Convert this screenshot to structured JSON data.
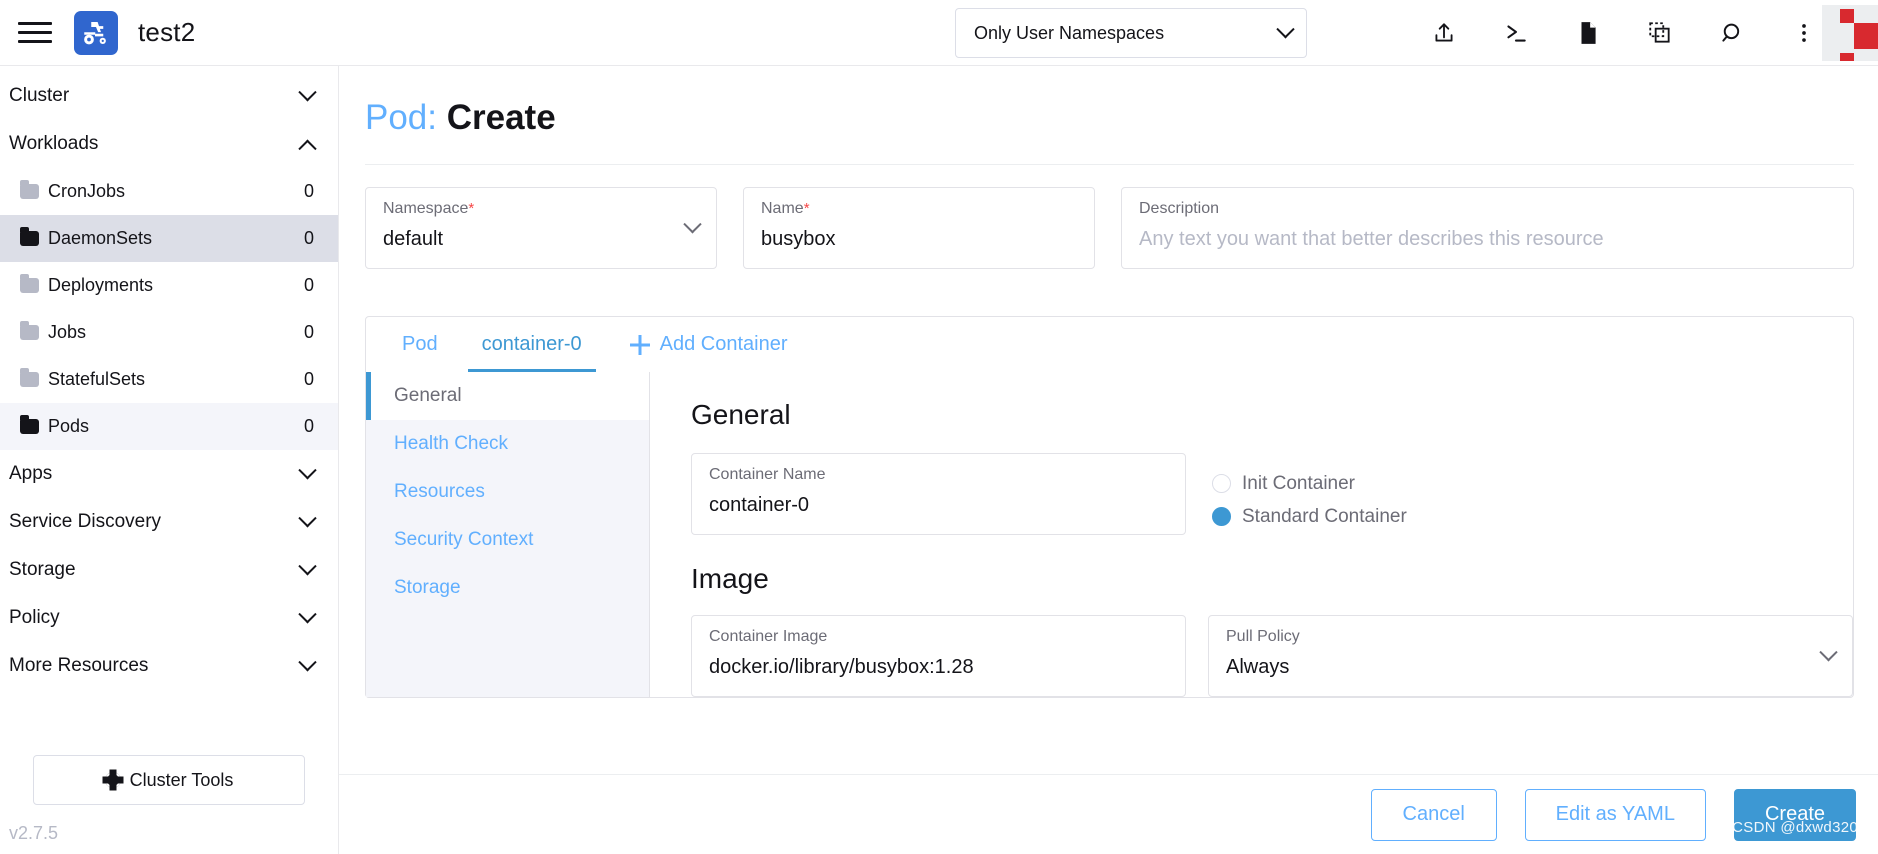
{
  "header": {
    "menu_icon": "hamburger-menu-icon",
    "logo_icon": "rancher-tractor-logo",
    "cluster_name": "test2",
    "namespace_filter": {
      "value": "Only User Namespaces",
      "chevron": "chevron-down-icon"
    },
    "actions": [
      {
        "name": "import-yaml-icon",
        "glyph": "upload"
      },
      {
        "name": "kubectl-shell-icon",
        "glyph": "terminal"
      },
      {
        "name": "docs-icon",
        "glyph": "file"
      },
      {
        "name": "download-kubeconfig-icon",
        "glyph": "copy"
      },
      {
        "name": "search-icon",
        "glyph": "search"
      },
      {
        "name": "overflow-menu-icon",
        "glyph": "dots"
      }
    ],
    "avatar": "user-avatar"
  },
  "sidebar": {
    "groups": [
      {
        "label": "Cluster",
        "expanded": false
      },
      {
        "label": "Workloads",
        "expanded": true
      }
    ],
    "workload_items": [
      {
        "label": "CronJobs",
        "count": "0",
        "state": ""
      },
      {
        "label": "DaemonSets",
        "count": "0",
        "state": "active"
      },
      {
        "label": "Deployments",
        "count": "0",
        "state": ""
      },
      {
        "label": "Jobs",
        "count": "0",
        "state": ""
      },
      {
        "label": "StatefulSets",
        "count": "0",
        "state": ""
      },
      {
        "label": "Pods",
        "count": "0",
        "state": "soft"
      }
    ],
    "groups_after": [
      {
        "label": "Apps"
      },
      {
        "label": "Service Discovery"
      },
      {
        "label": "Storage"
      },
      {
        "label": "Policy"
      },
      {
        "label": "More Resources"
      }
    ],
    "cluster_tools_label": "Cluster Tools",
    "cluster_tools_icon": "gear-icon",
    "version": "v2.7.5"
  },
  "page": {
    "title_resource": "Pod:",
    "title_action": "Create",
    "namespace": {
      "label": "Namespace",
      "required": "*",
      "value": "default"
    },
    "name": {
      "label": "Name",
      "required": "*",
      "value": "busybox"
    },
    "description": {
      "label": "Description",
      "placeholder": "Any text you want that better describes this resource",
      "value": ""
    }
  },
  "tabs": [
    {
      "label": "Pod",
      "active": false
    },
    {
      "label": "container-0",
      "active": true
    }
  ],
  "add_container_label": "Add Container",
  "subnav": [
    {
      "label": "General",
      "active": true
    },
    {
      "label": "Health Check",
      "active": false
    },
    {
      "label": "Resources",
      "active": false
    },
    {
      "label": "Security Context",
      "active": false
    },
    {
      "label": "Storage",
      "active": false
    }
  ],
  "general": {
    "section_title": "General",
    "container_name": {
      "label": "Container Name",
      "value": "container-0"
    },
    "container_type": {
      "options": [
        {
          "label": "Init Container",
          "selected": false
        },
        {
          "label": "Standard Container",
          "selected": true
        }
      ]
    },
    "image_section_title": "Image",
    "container_image": {
      "label": "Container Image",
      "value": "docker.io/library/busybox:1.28"
    },
    "pull_policy": {
      "label": "Pull Policy",
      "value": "Always"
    }
  },
  "footer": {
    "cancel_label": "Cancel",
    "edit_yaml_label": "Edit as YAML",
    "create_label": "Create"
  },
  "watermark": "CSDN @dxwd320",
  "colors": {
    "accent_blue": "#3d98d3",
    "link_blue": "#61affe",
    "brand_blue": "#3066ce",
    "required_red": "#f64747",
    "avatar_red": "#d8292f"
  }
}
